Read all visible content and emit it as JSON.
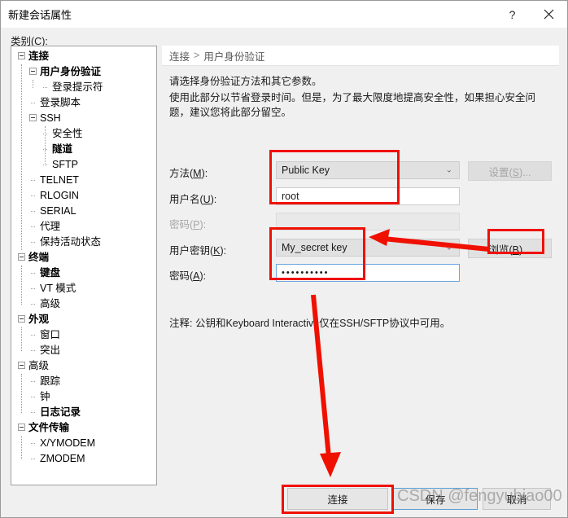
{
  "window": {
    "title": "新建会话属性",
    "help_button": "?",
    "close_button": "✕",
    "help_icon": "question-mark-icon",
    "close_icon": "close-icon"
  },
  "category": {
    "label_prefix": "类别(",
    "accel": "C",
    "label_suffix": "):"
  },
  "tree": {
    "items": [
      {
        "label": "连接",
        "level": 0,
        "bold": true,
        "expander": true
      },
      {
        "label": "用户身份验证",
        "level": 1,
        "bold": true,
        "expander": true
      },
      {
        "label": "登录提示符",
        "level": 2,
        "bold": false,
        "expander": false
      },
      {
        "label": "登录脚本",
        "level": 1,
        "bold": false,
        "expander": false
      },
      {
        "label": "SSH",
        "level": 1,
        "bold": false,
        "expander": true
      },
      {
        "label": "安全性",
        "level": 2,
        "bold": false,
        "expander": false
      },
      {
        "label": "隧道",
        "level": 2,
        "bold": true,
        "expander": false
      },
      {
        "label": "SFTP",
        "level": 2,
        "bold": false,
        "expander": false
      },
      {
        "label": "TELNET",
        "level": 1,
        "bold": false,
        "expander": false
      },
      {
        "label": "RLOGIN",
        "level": 1,
        "bold": false,
        "expander": false
      },
      {
        "label": "SERIAL",
        "level": 1,
        "bold": false,
        "expander": false
      },
      {
        "label": "代理",
        "level": 1,
        "bold": false,
        "expander": false
      },
      {
        "label": "保持活动状态",
        "level": 1,
        "bold": false,
        "expander": false
      },
      {
        "label": "终端",
        "level": 0,
        "bold": true,
        "expander": true
      },
      {
        "label": "键盘",
        "level": 1,
        "bold": true,
        "expander": false
      },
      {
        "label": "VT 模式",
        "level": 1,
        "bold": false,
        "expander": false
      },
      {
        "label": "高级",
        "level": 1,
        "bold": false,
        "expander": false
      },
      {
        "label": "外观",
        "level": 0,
        "bold": true,
        "expander": true
      },
      {
        "label": "窗口",
        "level": 1,
        "bold": false,
        "expander": false
      },
      {
        "label": "突出",
        "level": 1,
        "bold": false,
        "expander": false
      },
      {
        "label": "高级",
        "level": 0,
        "bold": false,
        "expander": true
      },
      {
        "label": "跟踪",
        "level": 1,
        "bold": false,
        "expander": false
      },
      {
        "label": "钟",
        "level": 1,
        "bold": false,
        "expander": false
      },
      {
        "label": "日志记录",
        "level": 1,
        "bold": true,
        "expander": false
      },
      {
        "label": "文件传输",
        "level": 0,
        "bold": true,
        "expander": true
      },
      {
        "label": "X/YMODEM",
        "level": 1,
        "bold": false,
        "expander": false
      },
      {
        "label": "ZMODEM",
        "level": 1,
        "bold": false,
        "expander": false
      }
    ]
  },
  "content": {
    "breadcrumb_root": "连接",
    "breadcrumb_sep": ">",
    "breadcrumb_leaf": "用户身份验证",
    "description_line1": "请选择身份验证方法和其它参数。",
    "description_line2": "使用此部分以节省登录时间。但是，为了最大限度地提高安全性，如果担心安全问题，建议您将此部分留空。",
    "note": "注释: 公钥和Keyboard Interactive仅在SSH/SFTP协议中可用。",
    "fields": {
      "method": {
        "label_prefix": "方法(",
        "accel": "M",
        "label_suffix": "):",
        "value": "Public Key",
        "chevron": "⌄"
      },
      "username": {
        "label_prefix": "用户名(",
        "accel": "U",
        "label_suffix": "):",
        "value": "root"
      },
      "password_disabled": {
        "label_prefix": "密码(",
        "accel": "P",
        "label_suffix": "):",
        "value": ""
      },
      "userkey": {
        "label_prefix": "用户密钥(",
        "accel": "K",
        "label_suffix": "):",
        "value": "My_secret key",
        "chevron": "⌄"
      },
      "passphrase": {
        "label_prefix": "密码(",
        "accel": "A",
        "label_suffix": "):",
        "value": "••••••••••"
      }
    },
    "buttons": {
      "settings": {
        "prefix": "设置(",
        "accel": "S",
        "suffix": ")..."
      },
      "browse": {
        "prefix": "浏览(",
        "accel": "B",
        "suffix": ")..."
      }
    }
  },
  "footer": {
    "connect": "连接",
    "save": "保存",
    "cancel": "取消"
  },
  "watermark": {
    "text": "CSDN @fengyubiao00"
  },
  "annotations": {
    "accent_color": "#f01000",
    "boxes": [
      {
        "name": "method-username-highlight"
      },
      {
        "name": "userkey-passphrase-highlight"
      },
      {
        "name": "browse-button-highlight"
      },
      {
        "name": "connect-button-highlight"
      }
    ],
    "arrows": [
      {
        "name": "arrow-to-userkey"
      },
      {
        "name": "arrow-to-connect"
      }
    ]
  }
}
